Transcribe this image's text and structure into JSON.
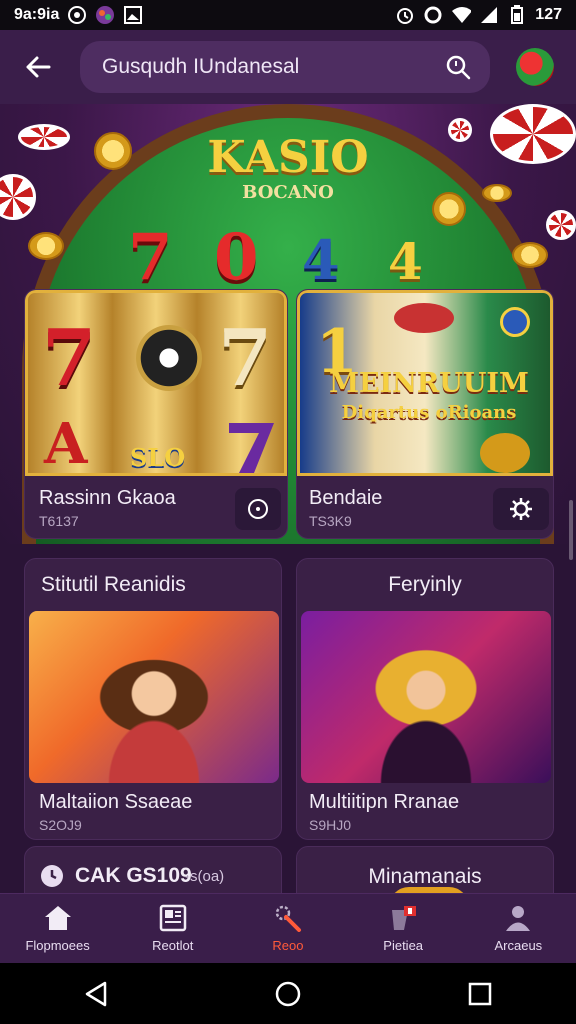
{
  "status_bar": {
    "time": "9a:9ia",
    "battery_text": "127"
  },
  "header": {
    "search_text": "Gusqudh IUndanesal"
  },
  "hero": {
    "title": "KASIO",
    "subtitle": "BOCANO",
    "felt_numbers": [
      "7",
      "0",
      "4",
      "4"
    ]
  },
  "games": [
    {
      "title": "Rassinn Gkaoa",
      "sub": "T6137",
      "action_icon": "info-icon"
    },
    {
      "title": "Bendaie",
      "sub": "TS3K9",
      "action_icon": "gear-icon",
      "banner": "MEINRUUIM",
      "banner_sub": "Diqartus oRioans"
    }
  ],
  "slot1_symbols": [
    "7",
    "A",
    "7",
    "SLO"
  ],
  "promos": [
    {
      "header": "Stitutil Reanidis",
      "title": "Maltaiion Ssaeae",
      "sub": "S2OJ9"
    },
    {
      "header": "Feryinly",
      "title": "Multiitipn Rranae",
      "sub": "S9HJ0"
    }
  ],
  "lower_cards": [
    {
      "title": "CAK GS109",
      "sub": "-s(oa)"
    },
    {
      "title": "Minamanais"
    }
  ],
  "bottom_nav": [
    {
      "label": "Flopmoees",
      "icon": "home-icon"
    },
    {
      "label": "Reotlot",
      "icon": "list-icon"
    },
    {
      "label": "Reoo",
      "icon": "wand-icon",
      "active": true
    },
    {
      "label": "Pietiea",
      "icon": "gift-icon"
    },
    {
      "label": "Arcaeus",
      "icon": "person-icon"
    }
  ],
  "colors": {
    "accent": "#ff5a3a",
    "surface": "#3a2046",
    "gold": "#f5d040"
  }
}
